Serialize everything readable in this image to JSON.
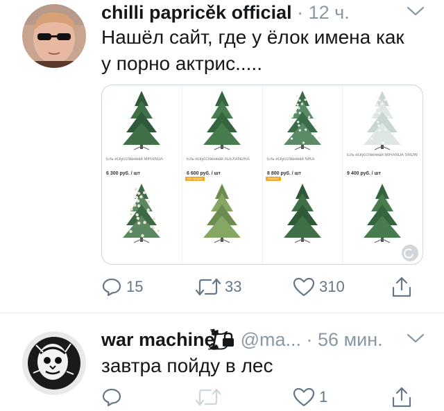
{
  "tweets": [
    {
      "author": "chilli papricěk official",
      "time": "· 12 ч.",
      "text": "Нашёл сайт, где у ёлок имена как\nу порно актрис.....",
      "products": [
        {
          "name": "Ель искусственная MIRANDA",
          "price": "6 300 руб. / шт",
          "badge": "",
          "tree": "dark-green"
        },
        {
          "name": "Ель искусственная ALEXANDRA",
          "price": "6 600 руб. / шт",
          "badge": "",
          "tree": "green"
        },
        {
          "name": "Ель искусственная NIKA",
          "price": "8 800 руб. / шт",
          "badge": "",
          "tree": "snow-dots"
        },
        {
          "name": "Ель искусственная MIRANDA SNOW",
          "price": "9 400 руб. / шт",
          "badge": "",
          "tree": "snowy"
        },
        {
          "name": "",
          "price": "",
          "badge": "",
          "tree": "cones"
        },
        {
          "name": "",
          "price": "",
          "badge": "Хит продаж",
          "tree": "light-green"
        },
        {
          "name": "",
          "price": "",
          "badge": "Новинка",
          "tree": "dark-green"
        },
        {
          "name": "",
          "price": "",
          "badge": "",
          "tree": "green"
        }
      ],
      "actions": {
        "replies": "15",
        "retweets": "33",
        "likes": "310"
      }
    },
    {
      "author": "war machinȩ̸̡̨̗̮̞̻̙͕̯̥̙̦̖̪͈̎͗̉̾̈́̆͌͌͘̚͜͝͝͝ͅ",
      "handle": "@ma...",
      "time": "· 56 мин.",
      "text": "завтра пойду в лес",
      "actions": {
        "replies": "",
        "retweets": "",
        "likes": "1"
      }
    }
  ],
  "colors": {
    "text": "#14171a",
    "muted": "#8899a6",
    "icon": "#657786",
    "border": "#ccd6dd"
  },
  "icons": [
    "chevron-down-icon",
    "reply-icon",
    "retweet-icon",
    "like-icon",
    "share-icon",
    "lock-icon"
  ]
}
